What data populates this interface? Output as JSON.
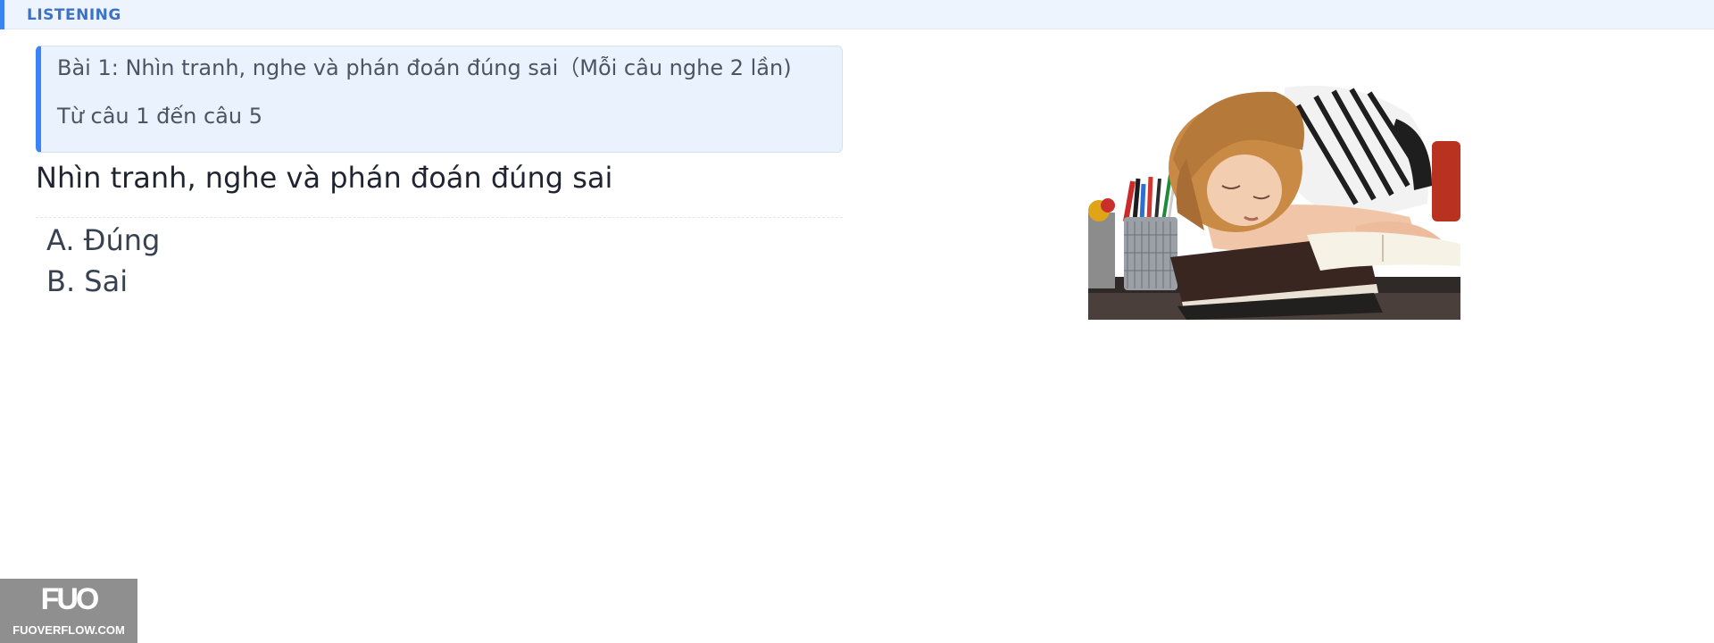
{
  "section": {
    "label": "LISTENING",
    "accent_color": "#3b82f6"
  },
  "instruction": {
    "line1": "Bài 1: Nhìn tranh, nghe và phán đoán đúng sai（Mỗi câu nghe 2 lần)",
    "line2": "Từ câu 1 đến câu 5"
  },
  "question": {
    "text": "Nhìn tranh, nghe và phán đoán đúng sai",
    "options": [
      {
        "label": "A. Đúng"
      },
      {
        "label": "B. Sai"
      }
    ]
  },
  "illustration": {
    "icon": "student-sleeping-on-desk-photo"
  },
  "watermark": {
    "logo": "FUO",
    "site": "FUOVERFLOW.COM"
  }
}
